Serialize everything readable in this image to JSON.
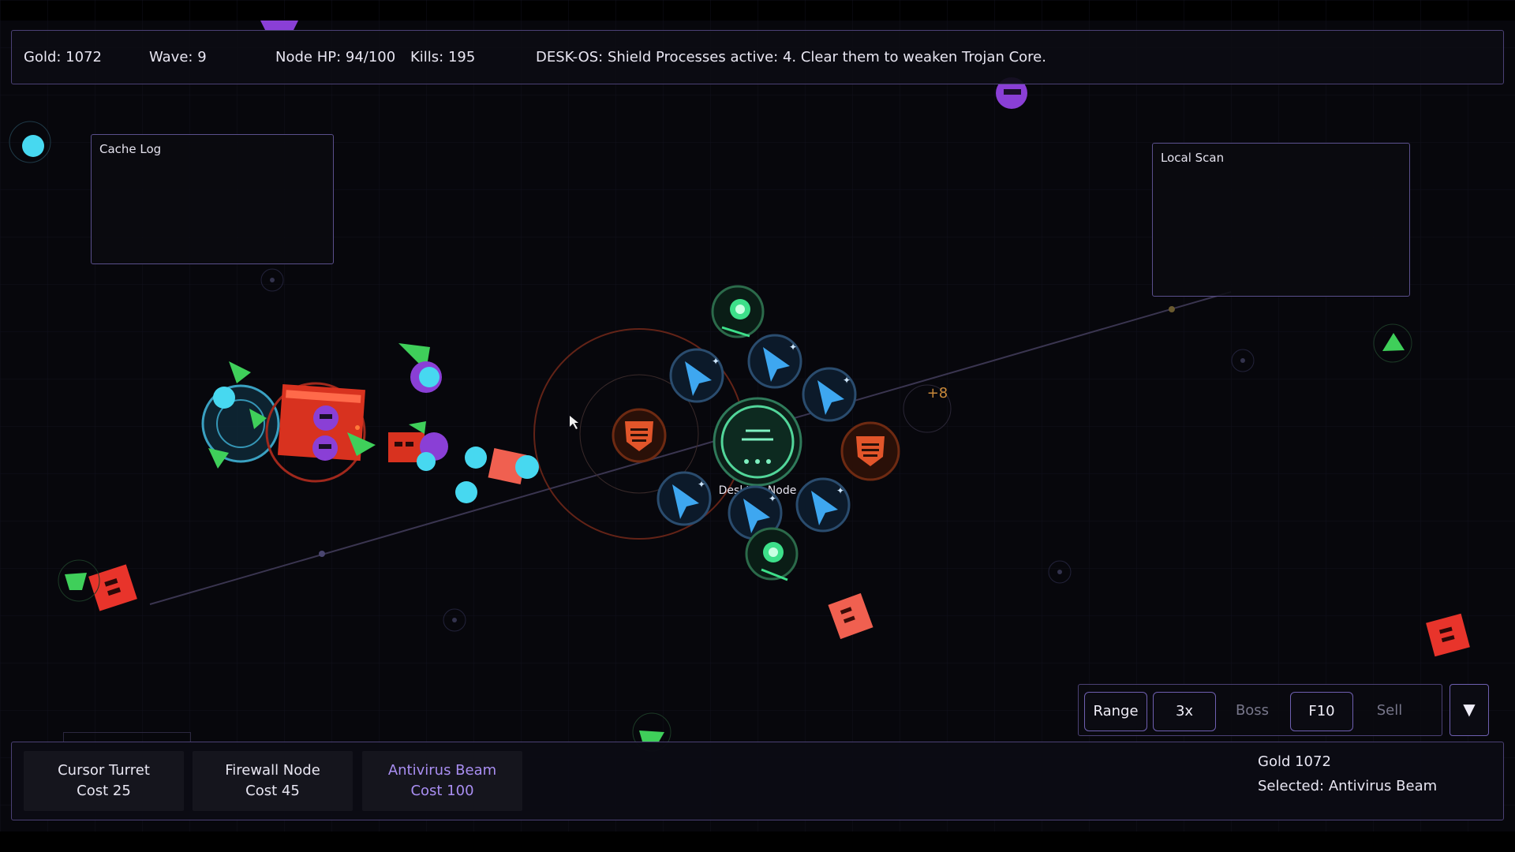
{
  "hud": {
    "gold": "Gold: 1072",
    "wave": "Wave: 9",
    "node_hp": "Node HP: 94/100",
    "kills": "Kills: 195",
    "message": "DESK-OS: Shield Processes active: 4. Clear them to weaken Trojan Core."
  },
  "panels": {
    "cache_log": "Cache Log",
    "local_scan": "Local Scan"
  },
  "field": {
    "core_label": "Desktop Node",
    "popup": "+8",
    "colors": {
      "background": "#07070c",
      "grid": "#141424",
      "accent": "#6e5fb0",
      "cursor_turret": "#3ea7f0",
      "firewall": "#e2552a",
      "beam": "#3de08a",
      "enemy_red": "#e8342b",
      "enemy_purple": "#8a3fd6",
      "enemy_green": "#3fcf5a",
      "enemy_cyan": "#47d8f0"
    }
  },
  "controls": {
    "range": "Range",
    "speed": "3x",
    "boss": "Boss",
    "f10": "F10",
    "sell": "Sell",
    "collapse_icon": "▼"
  },
  "build_menu": [
    {
      "name": "Cursor Turret",
      "cost": "Cost 25"
    },
    {
      "name": "Firewall Node",
      "cost": "Cost 45"
    },
    {
      "name": "Antivirus Beam",
      "cost": "Cost 100"
    }
  ],
  "info": {
    "gold": "Gold 1072",
    "selected": "Selected: Antivirus Beam"
  }
}
